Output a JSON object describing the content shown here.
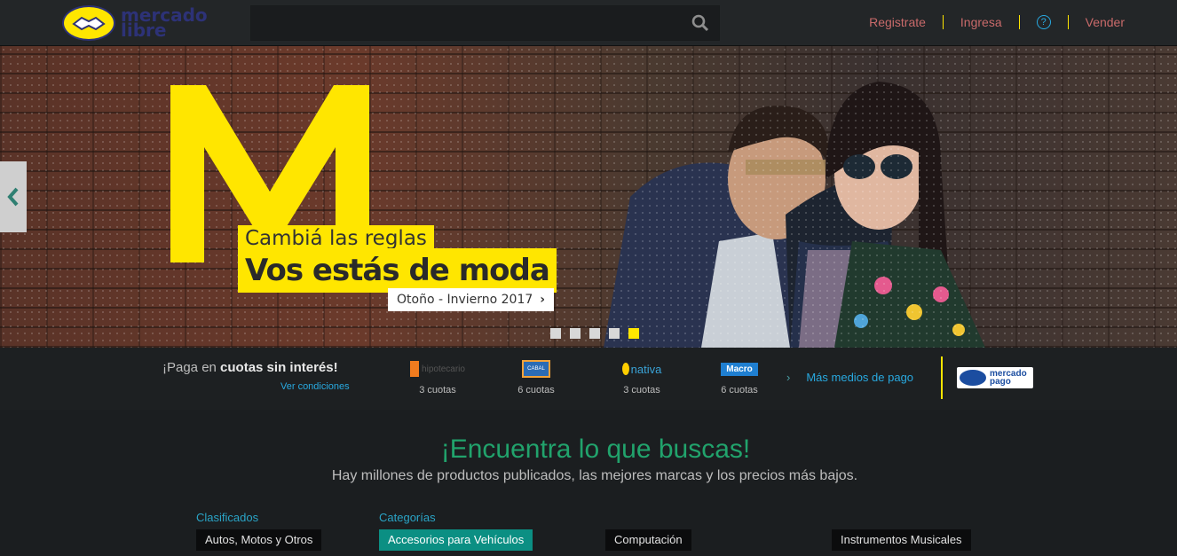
{
  "header": {
    "logo_line1": "mercado",
    "logo_line2": "libre",
    "search_placeholder": "",
    "nav": {
      "register": "Registrate",
      "login": "Ingresa",
      "help": "?",
      "sell": "Vender"
    }
  },
  "hero": {
    "caption_line1": "Cambiá las reglas",
    "caption_line2": "Vos estás de moda",
    "cta": "Otoño - Invierno 2017",
    "slide_count": 5,
    "active_slide": 5
  },
  "payment": {
    "title_prefix": "¡Paga en ",
    "title_bold": "cuotas sin interés!",
    "conditions_link": "Ver condiciones",
    "banks": [
      {
        "name": "hipotecario",
        "cuotas": "3 cuotas"
      },
      {
        "name": "CABAL",
        "cuotas": "6 cuotas"
      },
      {
        "name": "nativa",
        "cuotas": "3 cuotas"
      },
      {
        "name": "Macro",
        "cuotas": "6 cuotas"
      }
    ],
    "more_link": "Más medios de pago",
    "mp_line1": "mercado",
    "mp_line2": "pago"
  },
  "find": {
    "title": "¡Encuentra lo que buscas!",
    "subtitle": "Hay millones de productos publicados, las mejores marcas y los precios más bajos."
  },
  "sections": {
    "classifieds_label": "Clasificados",
    "categories_label": "Categorías",
    "items": [
      "Autos, Motos y Otros",
      "Accesorios para Vehículos",
      "Computación",
      "Instrumentos Musicales"
    ]
  },
  "colors": {
    "brand_yellow": "#ffe600",
    "accent_green": "#21a36c",
    "link_blue": "#28a9e0"
  }
}
